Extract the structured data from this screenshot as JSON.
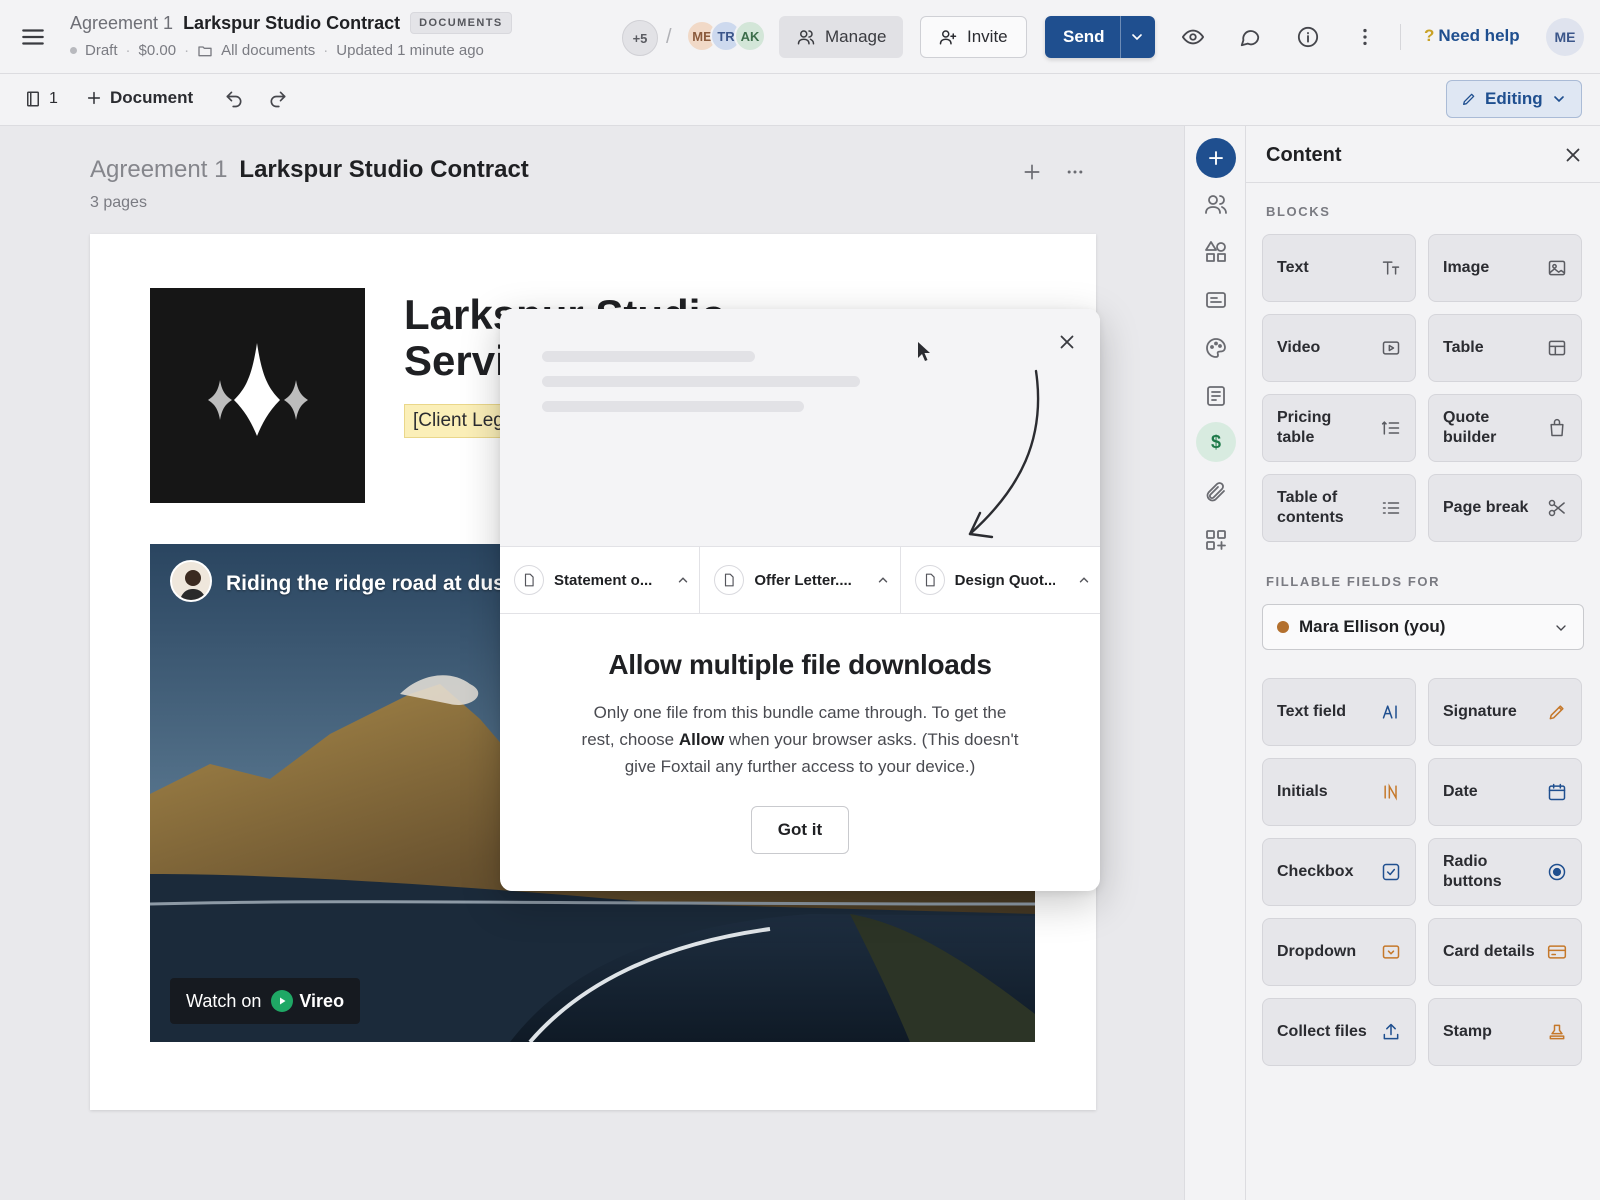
{
  "header": {
    "title_prefix": "Agreement 1",
    "title": "Larkspur Studio Contract",
    "badge": "DOCUMENTS",
    "status": "Draft",
    "amount": "$0.00",
    "folder": "All documents",
    "updated": "Updated 1 minute ago",
    "more_users": "+5",
    "avatars": [
      "ME",
      "TR",
      "AK"
    ],
    "manage_label": "Manage",
    "invite_label": "Invite",
    "send_label": "Send",
    "help_label": "Need help",
    "help_mark": "?",
    "user_initials": "ME"
  },
  "toolbar": {
    "page_count": "1",
    "add_document_label": "Document",
    "mode_label": "Editing"
  },
  "document": {
    "title_prefix": "Agreement 1",
    "title": "Larkspur Studio Contract",
    "pages": "3 pages",
    "heading_line1": "Larkspur Studio",
    "heading_line2": "Servi",
    "client_placeholder": "[Client Leg"
  },
  "video": {
    "title": "Riding the ridge road at dusk",
    "watch_on": "Watch on",
    "brand": "Vireo"
  },
  "modal": {
    "downloads": [
      {
        "name": "Statement o..."
      },
      {
        "name": "Offer Letter...."
      },
      {
        "name": "Design Quot..."
      }
    ],
    "heading": "Allow multiple file downloads",
    "body_before": "Only one file from this bundle came through. To get the rest, choose ",
    "body_bold": "Allow",
    "body_after": " when your browser asks. (This doesn't give Foxtail any further access to your device.)",
    "button": "Got it"
  },
  "panel": {
    "title": "Content",
    "blocks_label": "BLOCKS",
    "blocks": [
      {
        "label": "Text",
        "icon": "text-size-icon"
      },
      {
        "label": "Image",
        "icon": "image-icon"
      },
      {
        "label": "Video",
        "icon": "video-icon"
      },
      {
        "label": "Table",
        "icon": "table-icon"
      },
      {
        "label": "Pricing table",
        "icon": "pricing-list-icon"
      },
      {
        "label": "Quote builder",
        "icon": "bag-icon"
      },
      {
        "label": "Table of contents",
        "icon": "toc-list-icon"
      },
      {
        "label": "Page break",
        "icon": "scissors-icon"
      }
    ],
    "fillable_label": "FILLABLE FIELDS FOR",
    "fillable_user": "Mara Ellison (you)",
    "fields": [
      {
        "label": "Text field",
        "icon": "text-field-icon"
      },
      {
        "label": "Signature",
        "icon": "pen-icon"
      },
      {
        "label": "Initials",
        "icon": "initials-icon"
      },
      {
        "label": "Date",
        "icon": "calendar-icon"
      },
      {
        "label": "Checkbox",
        "icon": "checkbox-icon"
      },
      {
        "label": "Radio buttons",
        "icon": "radio-icon"
      },
      {
        "label": "Dropdown",
        "icon": "dropdown-icon"
      },
      {
        "label": "Card details",
        "icon": "card-icon"
      },
      {
        "label": "Collect files",
        "icon": "upload-icon"
      },
      {
        "label": "Stamp",
        "icon": "stamp-icon"
      }
    ]
  },
  "colors": {
    "accent": "#1f4f8f",
    "placeholder_highlight": "#fbefb8",
    "user_dot": "#b3702e"
  }
}
